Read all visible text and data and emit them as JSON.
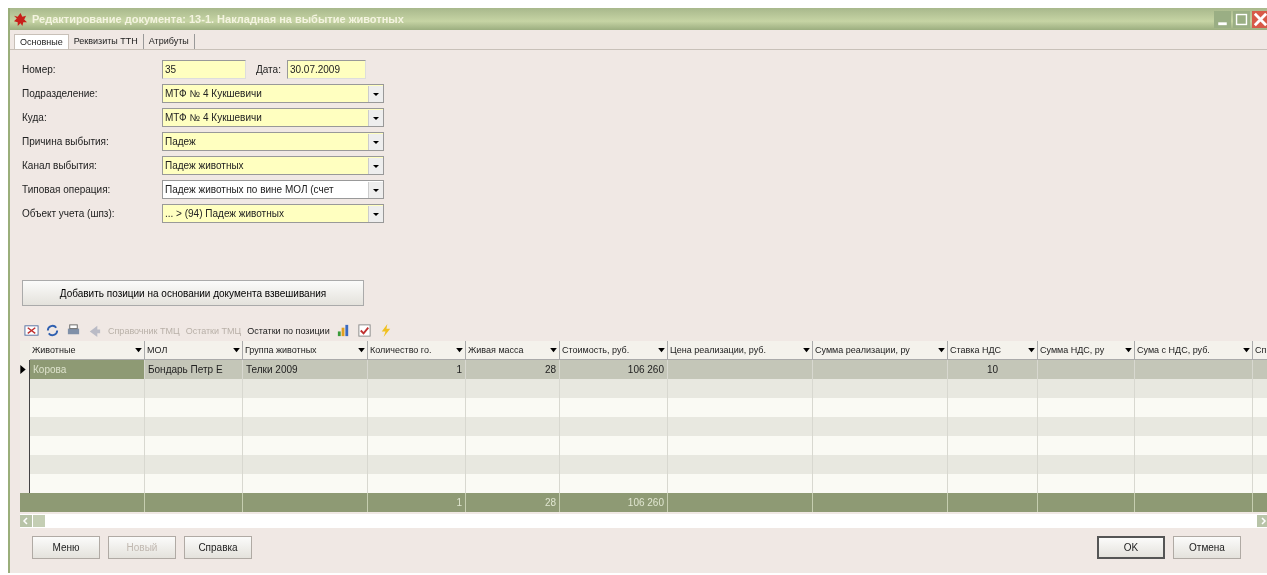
{
  "window": {
    "title": "Редактирование документа: 13-1. Накладная на выбытие животных"
  },
  "tabs": [
    {
      "label": "Основные",
      "selected": true
    },
    {
      "label": "Реквизиты ТТН",
      "selected": false
    },
    {
      "label": "Атрибуты",
      "selected": false
    }
  ],
  "number_field": {
    "label": "Номер:",
    "value": "35"
  },
  "date_field": {
    "label": "Дата:",
    "value": "30.07.2009"
  },
  "fields": [
    {
      "label": "Подразделение:",
      "value": "МТФ № 4 Кукшевичи",
      "highlighted": true
    },
    {
      "label": "Куда:",
      "value": "МТФ № 4 Кукшевичи",
      "highlighted": true
    },
    {
      "label": "Причина выбытия:",
      "value": "Падеж",
      "highlighted": true
    },
    {
      "label": "Канал выбытия:",
      "value": "Падеж животных",
      "highlighted": true
    },
    {
      "label": "Типовая операция:",
      "value": "Падеж животных по вине МОЛ (счет",
      "highlighted": false
    },
    {
      "label": "Объект учета (шпз):",
      "value": "... > (94) Падеж животных",
      "highlighted": true
    }
  ],
  "add_button": "Добавить позиции на основании документа взвешивания",
  "toolbar": [
    {
      "kind": "icon",
      "disabled": false
    },
    {
      "kind": "icon",
      "disabled": false
    },
    {
      "kind": "icon",
      "disabled": false
    },
    {
      "kind": "icon",
      "disabled": true
    },
    {
      "kind": "text",
      "label": "Справочник ТМЦ",
      "disabled": true
    },
    {
      "kind": "text",
      "label": "Остатки ТМЦ",
      "disabled": true
    },
    {
      "kind": "text",
      "label": "Остатки по позиции",
      "disabled": false
    },
    {
      "kind": "icon",
      "disabled": false
    },
    {
      "kind": "icon",
      "disabled": false
    },
    {
      "kind": "icon",
      "disabled": false
    }
  ],
  "table": {
    "columns": [
      "Животные",
      "МОЛ",
      "Группа животных",
      "Количество го.",
      "Живая масса",
      "Стоимость, руб.",
      "Цена реализации, руб.",
      "Сумма реализации, ру",
      "Ставка НДС",
      "Сумма НДС, ру",
      "Сума с НДС, руб.",
      "Сп"
    ],
    "rows": [
      {
        "selected": true,
        "animal": "Корова",
        "mol": "Бондарь Петр Е",
        "group": "Телки 2009",
        "quantity": "1",
        "live_weight": "28",
        "cost": "106 260",
        "vat_rate": "10"
      }
    ],
    "totals": {
      "quantity": "1",
      "live_weight": "28",
      "cost": "106 260"
    }
  },
  "buttons": [
    {
      "label": "Меню",
      "disabled": false,
      "default": false
    },
    {
      "label": "Новый",
      "disabled": true,
      "default": false
    },
    {
      "label": "Справка",
      "disabled": false,
      "default": false
    },
    {
      "label": "OK",
      "disabled": false,
      "default": true
    },
    {
      "label": "Отмена",
      "disabled": false,
      "default": false
    }
  ]
}
